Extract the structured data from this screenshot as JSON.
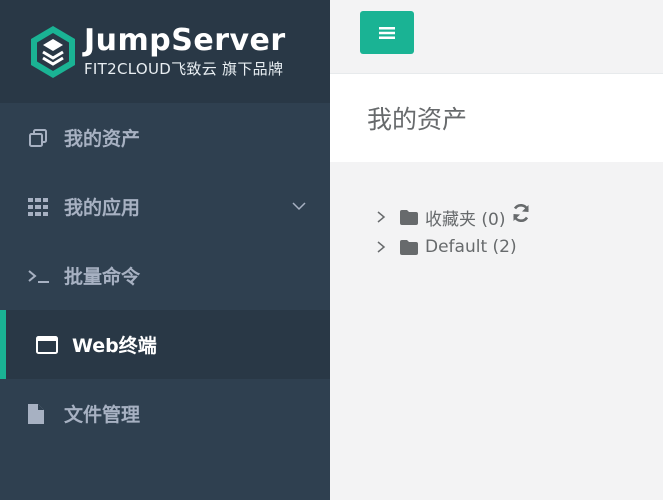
{
  "brand": {
    "name": "JumpServer",
    "subtitle": "FIT2CLOUD飞致云 旗下品牌",
    "accent": "#1ab394",
    "sidebar_bg": "#2f4050"
  },
  "sidebar": {
    "items": [
      {
        "label": "我的资产",
        "icon": "clone-icon"
      },
      {
        "label": "我的应用",
        "icon": "grid-icon"
      },
      {
        "label": "批量命令",
        "icon": "terminal-icon"
      },
      {
        "label": "Web终端",
        "icon": "window-icon",
        "active": true
      },
      {
        "label": "文件管理",
        "icon": "file-icon"
      }
    ]
  },
  "header": {
    "menu_button_icon": "bars-icon",
    "page_title": "我的资产"
  },
  "tree": {
    "nodes": [
      {
        "label": "收藏夹 (0)",
        "icon": "folder-icon",
        "action_icon": "refresh-icon"
      },
      {
        "label": "Default (2)",
        "icon": "folder-icon"
      }
    ]
  }
}
